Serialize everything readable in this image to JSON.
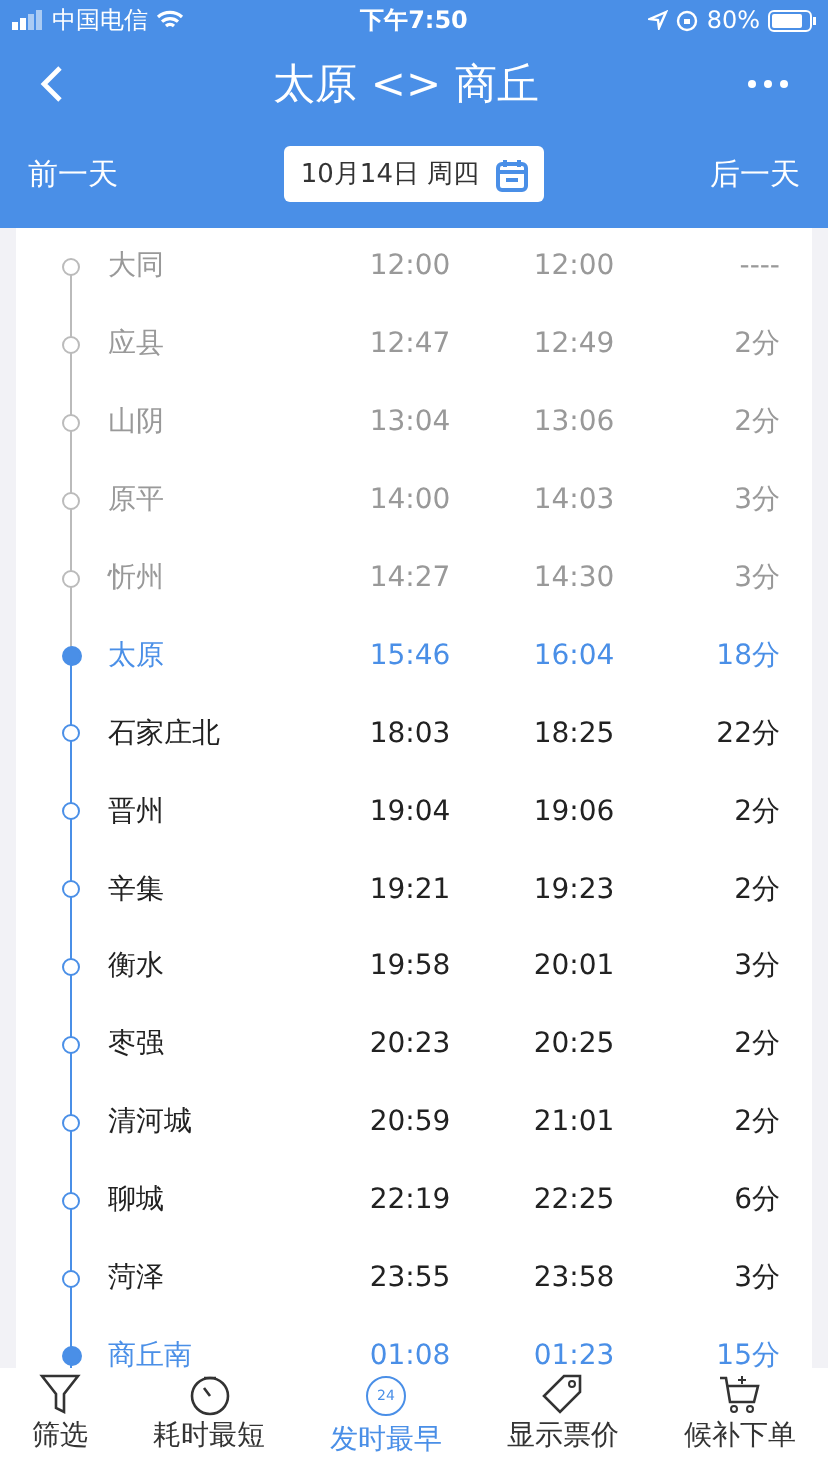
{
  "status_bar": {
    "carrier": "中国电信",
    "time": "下午7:50",
    "battery": "80%"
  },
  "nav": {
    "title": "太原 <> 商丘"
  },
  "date_bar": {
    "prev": "前一天",
    "date": "10月14日 周四",
    "next": "后一天"
  },
  "stops": [
    {
      "name": "大同",
      "arrive": "12:00",
      "depart": "12:00",
      "stay": "----",
      "kind": "passed"
    },
    {
      "name": "应县",
      "arrive": "12:47",
      "depart": "12:49",
      "stay": "2分",
      "kind": "passed"
    },
    {
      "name": "山阴",
      "arrive": "13:04",
      "depart": "13:06",
      "stay": "2分",
      "kind": "passed"
    },
    {
      "name": "原平",
      "arrive": "14:00",
      "depart": "14:03",
      "stay": "3分",
      "kind": "passed"
    },
    {
      "name": "忻州",
      "arrive": "14:27",
      "depart": "14:30",
      "stay": "3分",
      "kind": "passed"
    },
    {
      "name": "太原",
      "arrive": "15:46",
      "depart": "16:04",
      "stay": "18分",
      "kind": "endpoint"
    },
    {
      "name": "石家庄北",
      "arrive": "18:03",
      "depart": "18:25",
      "stay": "22分",
      "kind": "normal"
    },
    {
      "name": "晋州",
      "arrive": "19:04",
      "depart": "19:06",
      "stay": "2分",
      "kind": "normal"
    },
    {
      "name": "辛集",
      "arrive": "19:21",
      "depart": "19:23",
      "stay": "2分",
      "kind": "normal"
    },
    {
      "name": "衡水",
      "arrive": "19:58",
      "depart": "20:01",
      "stay": "3分",
      "kind": "normal"
    },
    {
      "name": "枣强",
      "arrive": "20:23",
      "depart": "20:25",
      "stay": "2分",
      "kind": "normal"
    },
    {
      "name": "清河城",
      "arrive": "20:59",
      "depart": "21:01",
      "stay": "2分",
      "kind": "normal"
    },
    {
      "name": "聊城",
      "arrive": "22:19",
      "depart": "22:25",
      "stay": "6分",
      "kind": "normal"
    },
    {
      "name": "菏泽",
      "arrive": "23:55",
      "depart": "23:58",
      "stay": "3分",
      "kind": "normal"
    },
    {
      "name": "商丘南",
      "arrive": "01:08",
      "depart": "01:23",
      "stay": "15分",
      "kind": "endpoint"
    }
  ],
  "tab_bar": [
    {
      "label": "筛选",
      "kind": "filter",
      "selected": false
    },
    {
      "label": "耗时最短",
      "kind": "timer",
      "selected": false
    },
    {
      "label": "发时最早",
      "kind": "clock",
      "icon_text": "24",
      "selected": true
    },
    {
      "label": "显示票价",
      "kind": "tag",
      "selected": false
    },
    {
      "label": "候补下单",
      "kind": "cart",
      "selected": false
    }
  ]
}
